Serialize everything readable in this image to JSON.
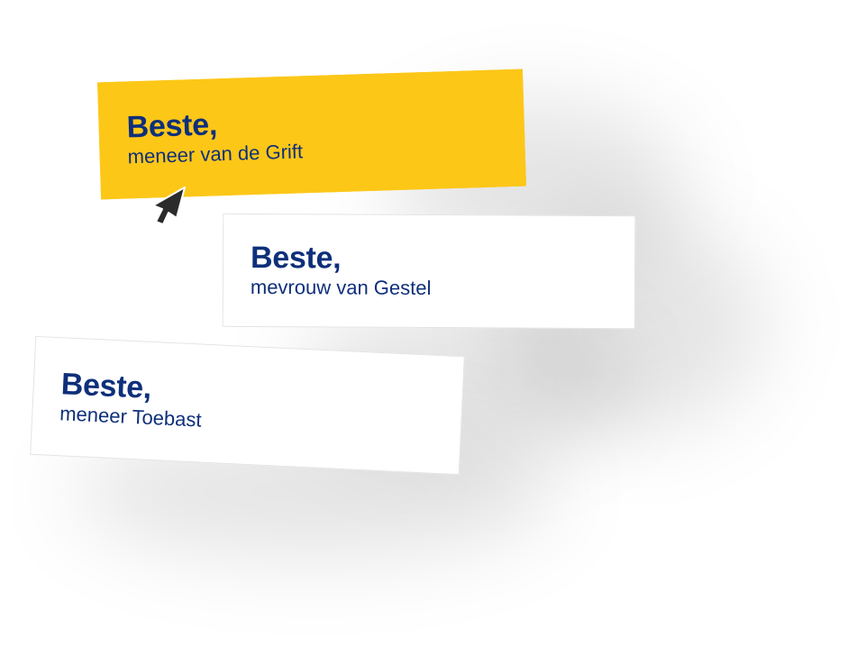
{
  "colors": {
    "accent_yellow": "#fdc718",
    "text_navy": "#0e2f7a",
    "card_background": "#ffffff",
    "cursor": "#2b2b2b"
  },
  "cards": [
    {
      "greeting": "Beste,",
      "name": "meneer van de Grift",
      "selected": true
    },
    {
      "greeting": "Beste,",
      "name": "mevrouw van Gestel",
      "selected": false
    },
    {
      "greeting": "Beste,",
      "name": "meneer Toebast",
      "selected": false
    }
  ],
  "cursor": {
    "icon": "mouse-pointer-icon"
  }
}
